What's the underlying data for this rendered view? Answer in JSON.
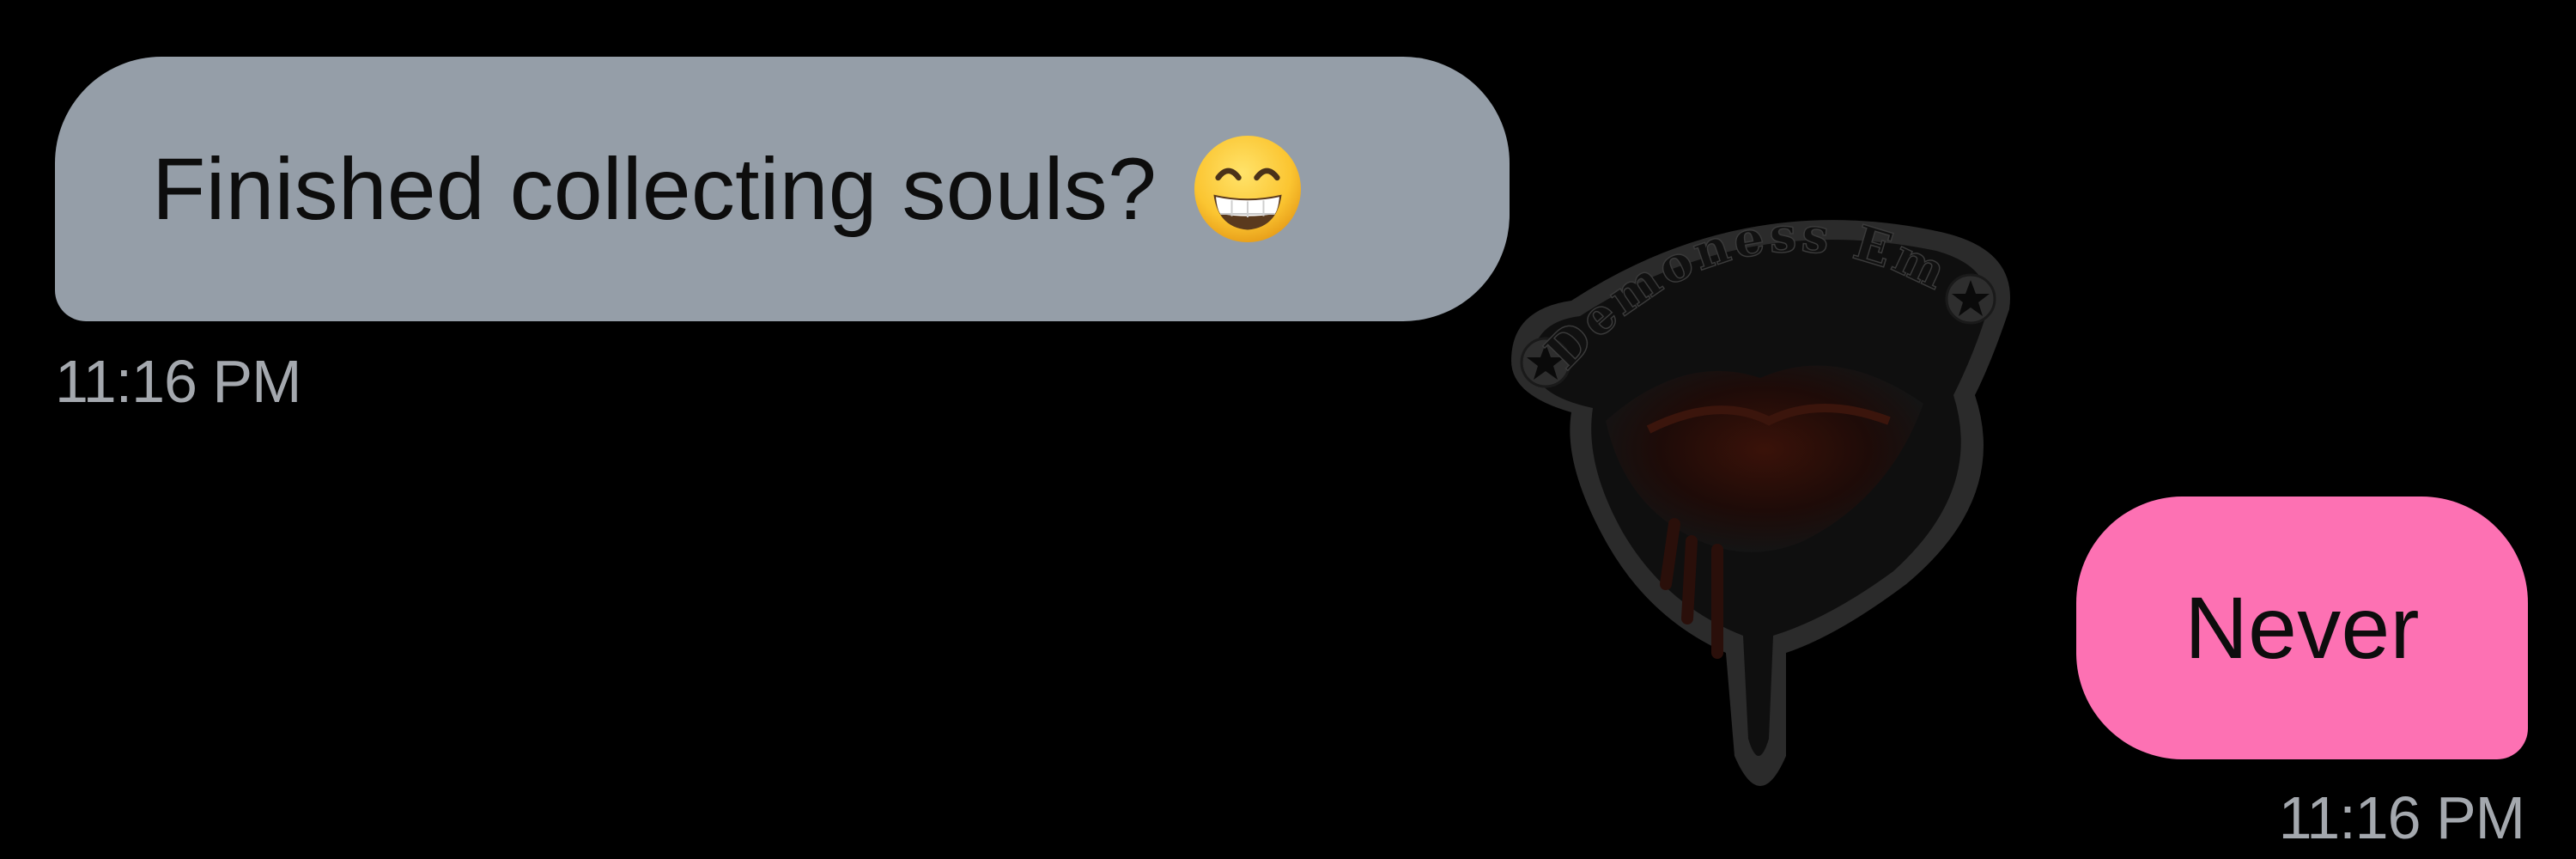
{
  "conversation": {
    "messages": [
      {
        "direction": "incoming",
        "text": "Finished collecting souls?",
        "emoji": "grinning-face-with-smiling-eyes-icon",
        "time": "11:16 PM"
      },
      {
        "direction": "outgoing",
        "text": "Never",
        "time": "11:16 PM"
      }
    ]
  },
  "watermark": {
    "text": "Demoness Em"
  },
  "colors": {
    "background": "#000000",
    "incoming_bubble": "#959ea8",
    "outgoing_bubble": "#fd71b3",
    "timestamp": "#a4a8ae",
    "bubble_text": "#0d0d0d"
  }
}
